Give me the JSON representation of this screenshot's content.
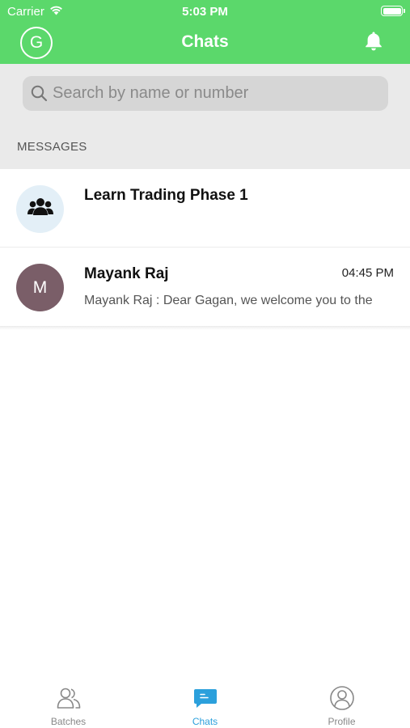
{
  "status_bar": {
    "carrier": "Carrier",
    "time": "5:03 PM",
    "battery_level": 1.0
  },
  "nav": {
    "avatar_letter": "G",
    "title": "Chats",
    "bell_icon": "bell-icon"
  },
  "search": {
    "placeholder": "Search by name or number",
    "icon": "search-icon"
  },
  "section": {
    "label": "MESSAGES"
  },
  "chats": [
    {
      "avatar_icon": "group-icon",
      "name": "Learn Trading Phase 1",
      "time": "",
      "preview": ""
    },
    {
      "avatar_letter": "M",
      "name": "Mayank Raj",
      "time": "04:45 PM",
      "preview": "Mayank Raj : Dear Gagan, we welcome you to the"
    }
  ],
  "tabs": [
    {
      "label": "Batches",
      "icon": "batches-icon",
      "active": false
    },
    {
      "label": "Chats",
      "icon": "chat-icon",
      "active": true
    },
    {
      "label": "Profile",
      "icon": "profile-icon",
      "active": false
    }
  ],
  "colors": {
    "header": "#5BD86B",
    "active_tab": "#2BA0DC",
    "group_avatar_bg": "#E3EFF7",
    "letter_avatar_bg": "#7A5E68",
    "search_bg": "#EAEAEA"
  }
}
